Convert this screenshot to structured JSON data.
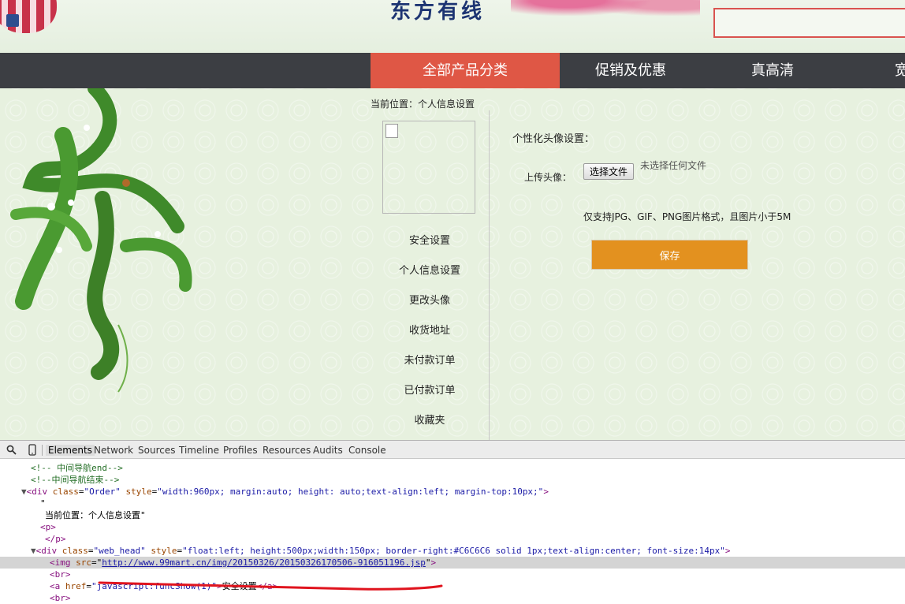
{
  "header": {
    "brand": "东方有线"
  },
  "nav": {
    "items": [
      {
        "label": "全部产品分类",
        "active": true
      },
      {
        "label": "促销及优惠",
        "active": false
      },
      {
        "label": "真高清",
        "active": false
      },
      {
        "label": "宽",
        "active": false
      }
    ]
  },
  "breadcrumb": "当前位置：个人信息设置",
  "sidebar": {
    "links": [
      "安全设置",
      "个人信息设置",
      "更改头像",
      "收货地址",
      "未付款订单",
      "已付款订单",
      "收藏夹"
    ]
  },
  "main": {
    "avatar_title": "个性化头像设置：",
    "upload_label": "上传头像：",
    "file_button": "选择文件",
    "file_status": "未选择任何文件",
    "format_note": "仅支持JPG、GIF、PNG图片格式，且图片小于5M",
    "save_button": "保存"
  },
  "devtools": {
    "tabs": [
      "Elements",
      "Network",
      "Sources",
      "Timeline",
      "Profiles",
      "Resources",
      "Audits",
      "Console"
    ],
    "active_tab": "Elements",
    "code": {
      "line1": "<!-- 中间导航end-->",
      "line2": "<!--中间导航结束-->",
      "line3_tag": "<div",
      "line3_a1": "class",
      "line3_v1": "\"Order\"",
      "line3_a2": "style",
      "line3_v2": "\"width:960px; margin:auto; height: auto;text-align:left; margin-top:10px;\"",
      "line4": "\"",
      "line5": "当前位置：个人信息设置\"",
      "line6": "<p>",
      "line7": "</p>",
      "line8_tag": "<div",
      "line8_a1": "class",
      "line8_v1": "\"web_head\"",
      "line8_a2": "style",
      "line8_v2": "\"float:left; height:500px;width:150px; border-right:#C6C6C6 solid 1px;text-align:center; font-size:14px\"",
      "line9_tag": "<img",
      "line9_a1": "src",
      "line9_url": "http://www.99mart.cn/img/20150326/20150326170506-916051196.jsp",
      "line10": "<br>",
      "line11_tag": "<a",
      "line11_a1": "href",
      "line11_v1": "\"javascript:funcShow(1)\"",
      "line11_text": "安全设置",
      "line11_close": "</a>",
      "line12": "<br>"
    }
  },
  "colors": {
    "nav_bg": "#3c3e43",
    "nav_active": "#df5745",
    "save_button": "#e3911f",
    "highlight_underline": "#e0141e"
  }
}
